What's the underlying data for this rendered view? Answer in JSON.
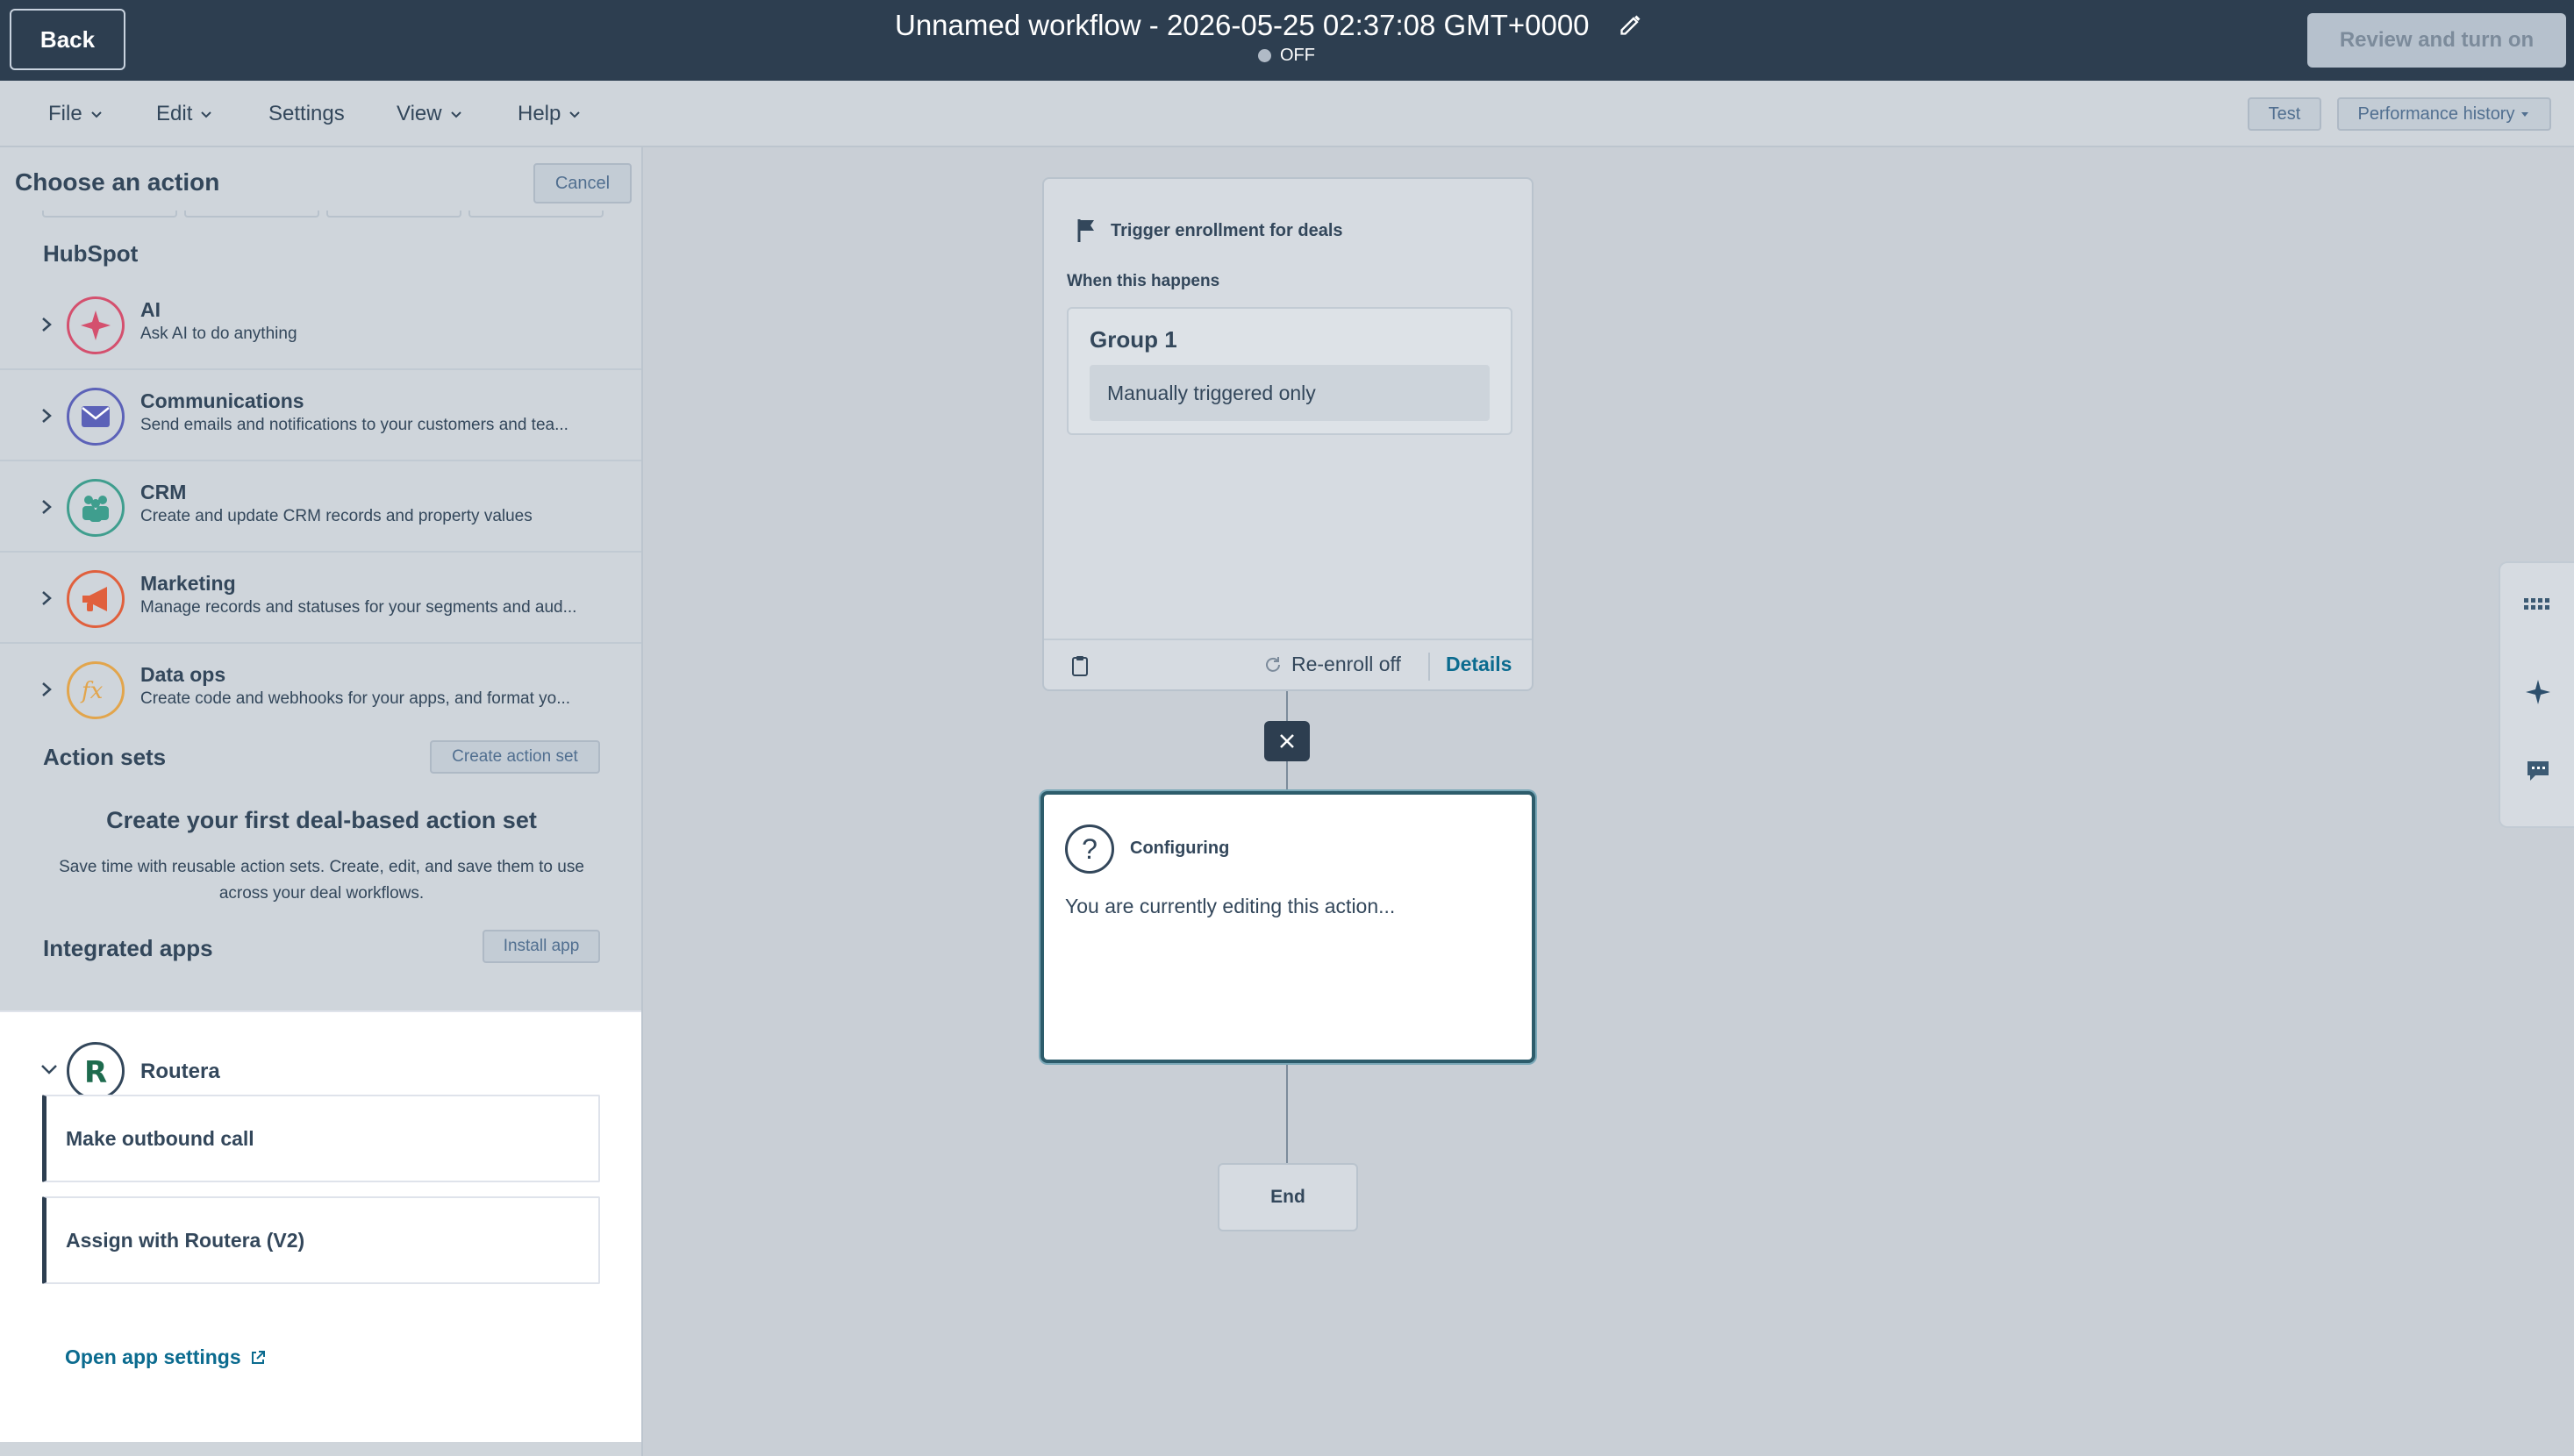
{
  "header": {
    "back_label": "Back",
    "title": "Unnamed workflow - 2026-05-25 02:37:08 GMT+0000",
    "status": "OFF",
    "review_label": "Review and turn on"
  },
  "menu": {
    "file": "File",
    "edit": "Edit",
    "settings": "Settings",
    "view": "View",
    "help": "Help",
    "test": "Test",
    "performance": "Performance history"
  },
  "panel": {
    "title": "Choose an action",
    "cancel": "Cancel",
    "hubspot_title": "HubSpot",
    "categories": [
      {
        "name": "AI",
        "desc": "Ask AI to do anything",
        "color": "#d4506e",
        "icon": "sparkle-icon"
      },
      {
        "name": "Communications",
        "desc": "Send emails and notifications to your customers and tea...",
        "color": "#5c62b8",
        "icon": "envelope-icon"
      },
      {
        "name": "CRM",
        "desc": "Create and update CRM records and property values",
        "color": "#3f9e8e",
        "icon": "people-icon"
      },
      {
        "name": "Marketing",
        "desc": "Manage records and statuses for your segments and aud...",
        "color": "#e0603d",
        "icon": "megaphone-icon"
      },
      {
        "name": "Data ops",
        "desc": "Create code and webhooks for your apps, and format yo...",
        "color": "#e2a54c",
        "icon": "function-icon"
      }
    ],
    "action_sets_title": "Action sets",
    "create_action_set": "Create action set",
    "empty_title": "Create your first deal-based action set",
    "empty_desc": "Save time with reusable action sets. Create, edit, and save them to use across your deal workflows.",
    "integrated_title": "Integrated apps",
    "install_app": "Install app",
    "app": {
      "name": "Routera",
      "actions": [
        "Make outbound call",
        "Assign with Routera (V2)"
      ],
      "open_settings": "Open app settings"
    }
  },
  "canvas": {
    "trigger_title": "Trigger enrollment for deals",
    "when_label": "When this happens",
    "group_title": "Group 1",
    "group_condition": "Manually triggered only",
    "reenroll": "Re-enroll off",
    "details": "Details",
    "config_title": "Configuring",
    "config_text": "You are currently editing this action...",
    "end_label": "End"
  },
  "colors": {
    "header_bg": "#2d3e50",
    "link": "#0b6b8f",
    "config_border": "#2d5c6b"
  }
}
